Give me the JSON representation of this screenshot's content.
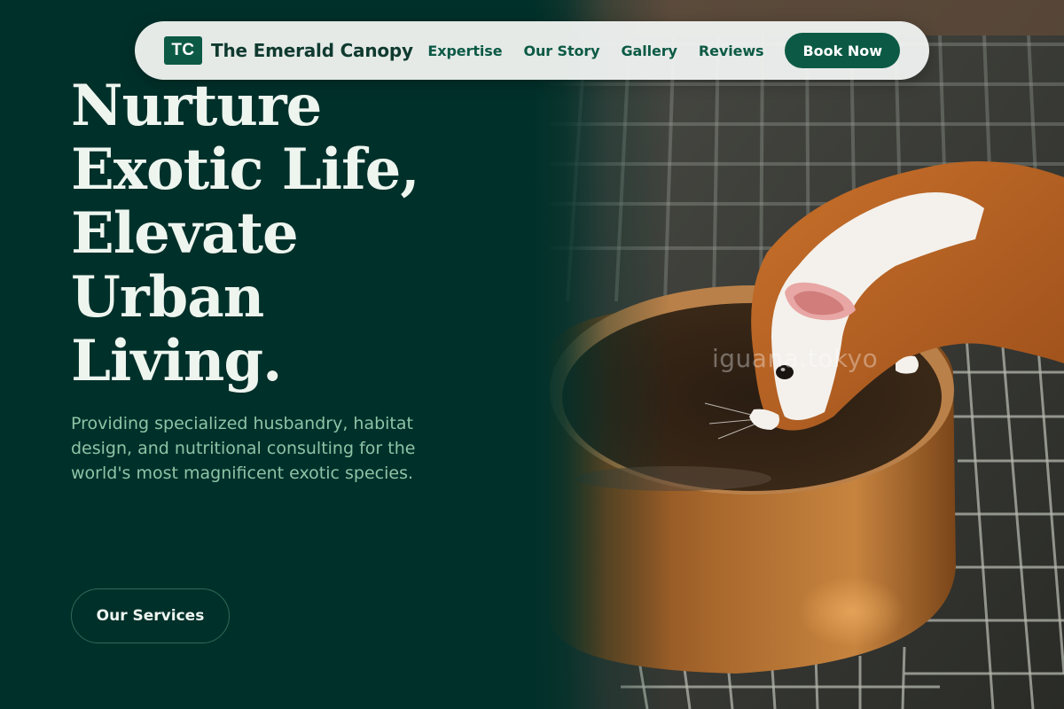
{
  "brand": {
    "mark": "TC",
    "name": "The Emerald Canopy"
  },
  "nav": {
    "links": [
      "Expertise",
      "Our Story",
      "Gallery",
      "Reviews"
    ],
    "cta_label": "Book Now"
  },
  "hero": {
    "headline_lines": [
      "Nurture",
      "Exotic Life,",
      "Elevate",
      "Urban",
      "Living."
    ],
    "subtitle": "Providing specialized husbandry, habitat design, and nutritional consulting for the world's most magnificent exotic species.",
    "primary_cta": "Our Services",
    "image_watermark": "iguana.tokyo"
  },
  "colors": {
    "background": "#00302a",
    "accent": "#0c5a45",
    "headline": "#eef5ef",
    "subtitle": "#8ec4a6",
    "nav_bg": "#eef1ef"
  },
  "icons": {
    "brand_mark": "tc-monogram-icon"
  }
}
